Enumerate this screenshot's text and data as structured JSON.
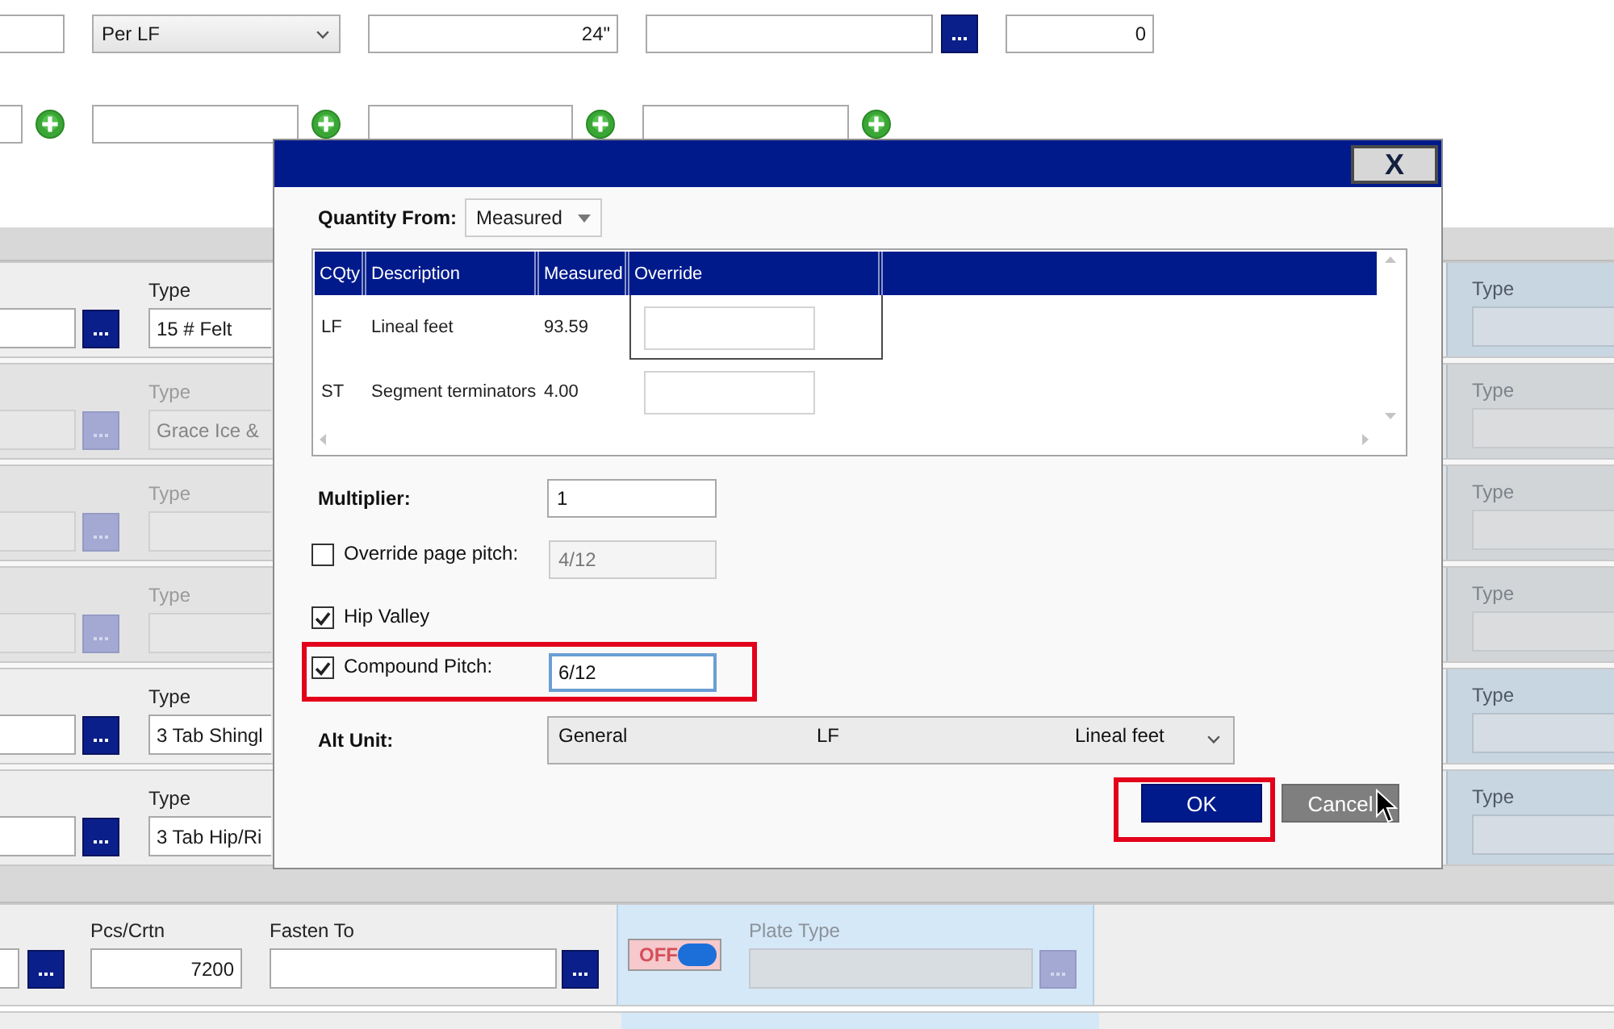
{
  "form": {
    "top_rows": [
      {
        "fields": [
          {
            "kind": "text"
          },
          {
            "kind": "dropdown",
            "value": "Per LF"
          },
          {
            "kind": "number",
            "value": "24\""
          },
          {
            "kind": "lookup"
          },
          {
            "kind": "number",
            "value": "0"
          }
        ]
      },
      {
        "fields": [
          {
            "kind": "add"
          },
          {
            "kind": "add"
          },
          {
            "kind": "add"
          },
          {
            "kind": "add"
          }
        ]
      }
    ],
    "type_rows": [
      {
        "label": "Type",
        "value": "15 # Felt",
        "side_label": "Type",
        "disabled": false
      },
      {
        "label": "Type",
        "value": "Grace Ice &",
        "side_label": "Type",
        "disabled": true
      },
      {
        "label": "Type",
        "side_label": "Type",
        "disabled": true
      },
      {
        "label": "Type",
        "side_label": "Type",
        "disabled": true
      },
      {
        "label": "Type",
        "value": "3 Tab Shingl",
        "side_label": "Type",
        "disabled": false
      },
      {
        "label": "Type",
        "value": "3 Tab Hip/Ri",
        "side_label": "Type",
        "disabled": false
      }
    ],
    "bottom_row": {
      "pcs_label": "Pcs/Crtn",
      "pcs_value": "7200",
      "fasten_label": "Fasten To",
      "toggle": {
        "label": "OFF",
        "on": false
      },
      "plate_label": "Plate Type",
      "plate_disabled": true
    }
  },
  "dialog": {
    "close_label": "X",
    "quantity_from": {
      "label": "Quantity From:",
      "value": "Measured"
    },
    "grid": {
      "columns": [
        "CQty",
        "Description",
        "Measured",
        "Override"
      ],
      "rows": [
        {
          "cells": [
            "LF",
            "Lineal feet",
            "93.59"
          ],
          "selected": true
        },
        {
          "cells": [
            "ST",
            "Segment terminators",
            "4.00"
          ],
          "selected": false
        }
      ]
    },
    "multiplier": {
      "label": "Multiplier:",
      "value": "1"
    },
    "options": [
      {
        "kind": "pitch",
        "label": "Override page pitch:",
        "checked": false,
        "value": "4/12",
        "disabled": true,
        "focused": false,
        "highlighted": false
      },
      {
        "kind": "plain",
        "label": "Hip Valley",
        "checked": true,
        "highlighted": false
      },
      {
        "kind": "pitch",
        "label": "Compound Pitch:",
        "checked": true,
        "value": "6/12",
        "disabled": false,
        "focused": true,
        "highlighted": true
      }
    ],
    "alt_unit": {
      "label": "Alt Unit:",
      "parts": [
        "General",
        "LF",
        "Lineal feet"
      ]
    },
    "buttons": [
      {
        "label": "OK",
        "kind": "primary",
        "highlighted": true
      },
      {
        "label": "Cancel",
        "kind": "secondary",
        "highlighted": false
      }
    ]
  }
}
